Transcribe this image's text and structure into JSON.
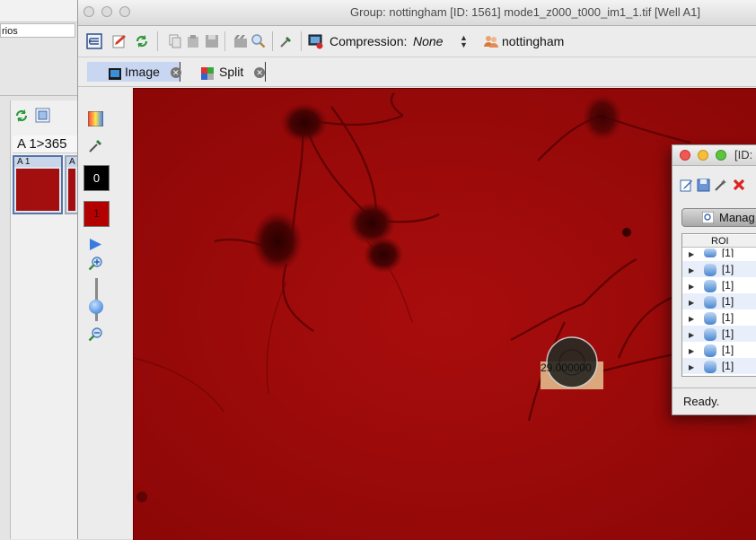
{
  "background_window": {
    "combo_text": "rios",
    "well_header": "A 1>365",
    "thumbnails": [
      {
        "label": "A 1"
      },
      {
        "label": "A"
      }
    ]
  },
  "main_window": {
    "title": "Group: nottingham [ID: 1561] mode1_z000_t000_im1_1.tif [Well A1]",
    "toolbar": {
      "compression_label": "Compression:",
      "compression_value": "None",
      "group_name": "nottingham"
    },
    "tabs": [
      {
        "label": "Image",
        "active": true
      },
      {
        "label": "Split",
        "active": false
      }
    ],
    "left_tools": {
      "channel_value": "0",
      "channel_value_2": "1"
    },
    "roi_measurement_label": "29.000000"
  },
  "roi_window": {
    "title": "[ID:",
    "tab_label": "Manag",
    "column_header": "ROI",
    "rows": [
      "[1]",
      "[1]",
      "[1]",
      "[1]",
      "[1]",
      "[1]",
      "[1]",
      "[1]"
    ],
    "status": "Ready."
  },
  "colors": {
    "image_red": "#9e0b0b",
    "selection_blue": "#5574a8",
    "active_tab": "#c9d6f2"
  }
}
